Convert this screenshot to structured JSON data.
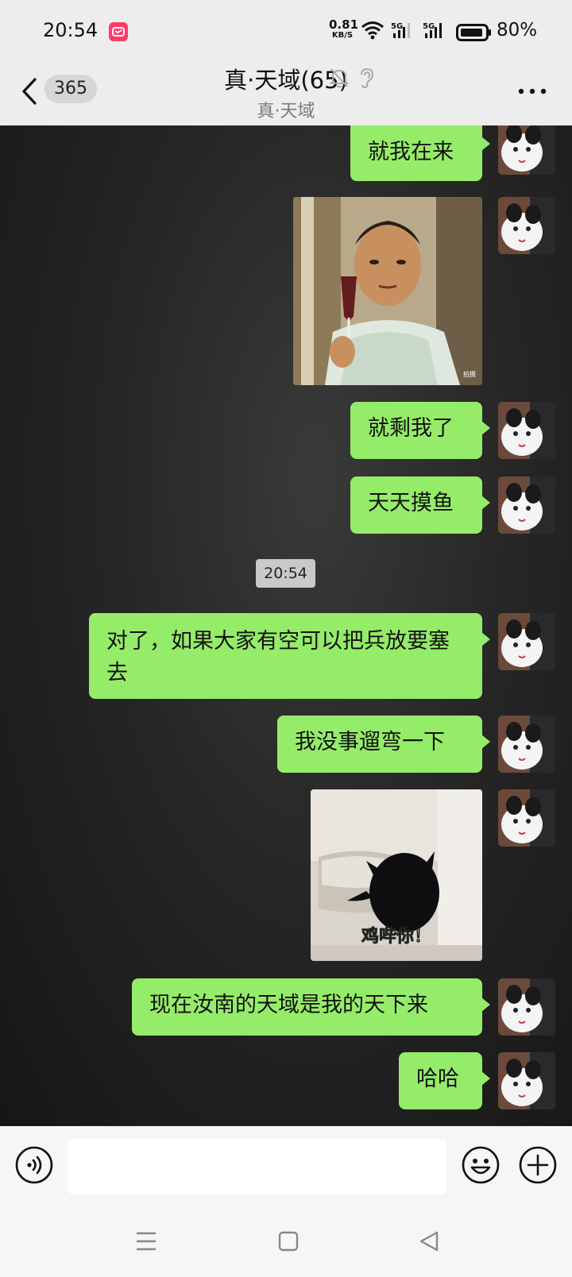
{
  "status_bar": {
    "time": "20:54",
    "net_speed": "0.81",
    "net_unit": "KB/S",
    "signal_1": "5G",
    "signal_2": "5G",
    "battery": "80%"
  },
  "header": {
    "unread_count": "365",
    "title": "真·天域(65)",
    "subtitle": "真·天域",
    "icons": [
      "mute-bell-icon",
      "ear-icon",
      "more-icon"
    ]
  },
  "colors": {
    "bubble": "#95ec69",
    "background": "#ededed",
    "chat_bg": "#222222"
  },
  "messages": [
    {
      "type": "text",
      "text": "就我在来"
    },
    {
      "type": "image",
      "description": "man-holding-wine-glass",
      "watermark": "拍摄"
    },
    {
      "type": "text",
      "text": "就剩我了"
    },
    {
      "type": "text",
      "text": "天天摸鱼"
    },
    {
      "type": "timestamp",
      "text": "20:54"
    },
    {
      "type": "text",
      "text": "对了，如果大家有空可以把兵放要塞去"
    },
    {
      "type": "text",
      "text": "我没事遛弯一下"
    },
    {
      "type": "image",
      "description": "black-cat-meme",
      "caption": "鸡哔你！"
    },
    {
      "type": "text",
      "text": "现在汝南的天域是我的天下来"
    },
    {
      "type": "text",
      "text": "哈哈"
    }
  ],
  "input": {
    "value": "",
    "placeholder": ""
  }
}
